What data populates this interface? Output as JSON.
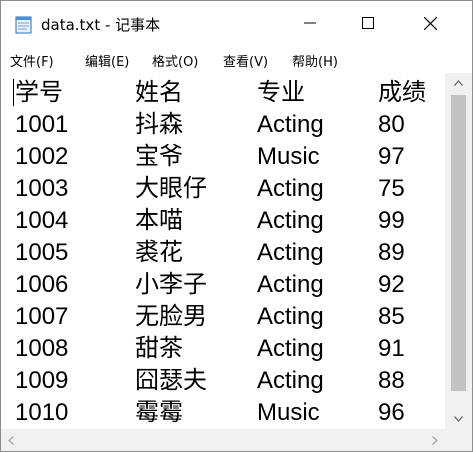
{
  "window": {
    "title": "data.txt - 记事本",
    "icon": "notepad-icon"
  },
  "controls": {
    "minimize_icon": "minimize-icon",
    "maximize_icon": "maximize-icon",
    "close_icon": "close-icon"
  },
  "menu": {
    "items": [
      {
        "label": "文件(F)"
      },
      {
        "label": "编辑(E)"
      },
      {
        "label": "格式(O)"
      },
      {
        "label": "查看(V)"
      },
      {
        "label": "帮助(H)"
      }
    ]
  },
  "document": {
    "header": [
      "学号",
      "姓名",
      "专业",
      "成绩"
    ],
    "rows": [
      [
        "1001",
        "抖森",
        "Acting",
        "80"
      ],
      [
        "1002",
        "宝爷",
        "Music",
        "97"
      ],
      [
        "1003",
        "大眼仔",
        "Acting",
        "75"
      ],
      [
        "1004",
        "本喵",
        "Acting",
        "99"
      ],
      [
        "1005",
        "裘花",
        "Acting",
        "89"
      ],
      [
        "1006",
        "小李子",
        "Acting",
        "92"
      ],
      [
        "1007",
        "无脸男",
        "Acting",
        "85"
      ],
      [
        "1008",
        "甜茶",
        "Acting",
        "91"
      ],
      [
        "1009",
        "囧瑟夫",
        "Acting",
        "88"
      ],
      [
        "1010",
        "霉霉",
        "Music",
        "96"
      ]
    ]
  },
  "scrollbars": {
    "up_icon": "arrow-up-icon",
    "down_icon": "arrow-down-icon",
    "left_icon": "arrow-left-icon",
    "right_icon": "arrow-right-icon"
  }
}
